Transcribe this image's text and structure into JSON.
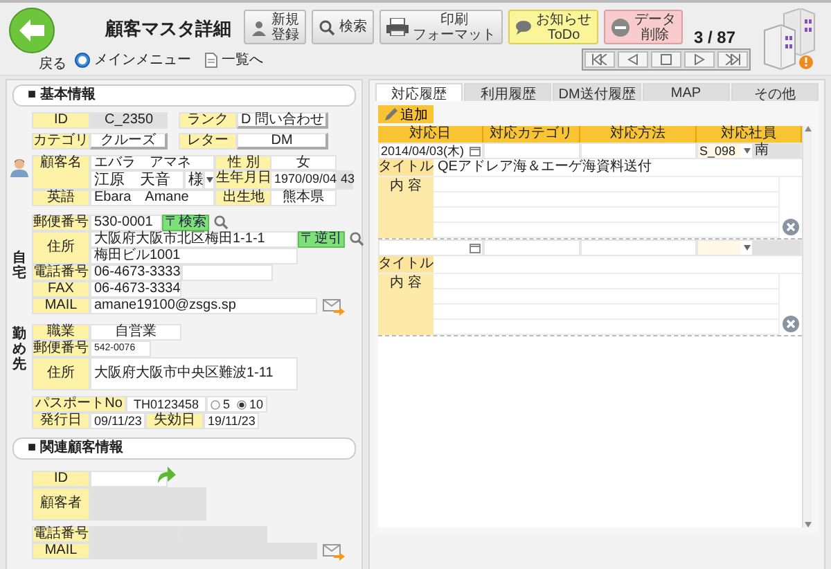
{
  "header": {
    "back_label": "戻る",
    "title": "顧客マスタ詳細",
    "buttons": [
      {
        "kind": "new",
        "lines": [
          "新規",
          "登録"
        ]
      },
      {
        "kind": "search",
        "lines": [
          "検索"
        ]
      },
      {
        "kind": "print",
        "lines": [
          "印刷",
          "フォーマット"
        ]
      },
      {
        "kind": "notice",
        "lines": [
          "お知らせ",
          "ToDo"
        ]
      },
      {
        "kind": "delete",
        "lines": [
          "データ",
          "削除"
        ]
      }
    ],
    "links": [
      {
        "kind": "home",
        "label": "メインメニュー"
      },
      {
        "kind": "list",
        "label": "一覧へ"
      }
    ],
    "counter": "3 / 87"
  },
  "basic": {
    "heading": "■ 基本情報",
    "id": {
      "label": "ID",
      "value": "C_2350"
    },
    "rank": {
      "label": "ランク",
      "value": "D 問い合わせ"
    },
    "category": {
      "label": "カテゴリ",
      "value": "クルーズ"
    },
    "letter": {
      "label": "レター",
      "value": "DM"
    },
    "name": {
      "label": "顧客名",
      "furigana": "エバラ　アマネ",
      "value": "江原　天音",
      "honorific": "様"
    },
    "gender": {
      "label": "性 別",
      "value": "女"
    },
    "birthdate": {
      "label": "生年月日",
      "value": "1970/09/04",
      "age": "43"
    },
    "english": {
      "label": "英語",
      "value": "Ebara　Amane"
    },
    "birthplace": {
      "label": "出生地",
      "value": "熊本県"
    }
  },
  "home": {
    "side_label": "自宅",
    "postal": {
      "label": "郵便番号",
      "value": "530-0001",
      "button": "〒検索"
    },
    "address": {
      "label": "住所",
      "line1": "大阪府大阪市北区梅田1-1-1",
      "line2": "梅田ビル1001",
      "button": "〒逆引"
    },
    "phone": {
      "label": "電話番号",
      "value": "06-4673-3333"
    },
    "fax": {
      "label": "FAX",
      "value": "06-4673-3334"
    },
    "mail": {
      "label": "MAIL",
      "value": "amane19100@zsgs.sp"
    }
  },
  "work": {
    "side_label": "勤め先",
    "occupation": {
      "label": "職業",
      "value": "自営業"
    },
    "postal": {
      "label": "郵便番号",
      "value": "542-0076"
    },
    "address": {
      "label": "住所",
      "value": "大阪府大阪市中央区難波1-11"
    }
  },
  "passport": {
    "label": "パスポートNo",
    "value": "TH0123458",
    "options": [
      {
        "label": "5",
        "selected": false
      },
      {
        "label": "10",
        "selected": true
      }
    ],
    "issued": {
      "label": "発行日",
      "value": "09/11/23"
    },
    "expires": {
      "label": "失効日",
      "value": "19/11/23"
    }
  },
  "related": {
    "heading": "■ 関連顧客情報",
    "id_label": "ID",
    "customer_label": "顧客者",
    "phone_label": "電話番号",
    "mail_label": "MAIL"
  },
  "tabs": [
    {
      "label": "対応履歴",
      "selected": true
    },
    {
      "label": "利用履歴",
      "selected": false
    },
    {
      "label": "DM送付履歴",
      "selected": false
    },
    {
      "label": "MAP",
      "selected": false
    },
    {
      "label": "その他",
      "selected": false
    }
  ],
  "add_button": "追加",
  "history": {
    "columns": [
      "対応日",
      "対応カテゴリ",
      "対応方法",
      "対応社員"
    ],
    "records": [
      {
        "date": "2014/04/03(木)",
        "staff_id": "S_098",
        "staff_name": "南",
        "title_label": "タイトル",
        "title": "QEアドレア海＆エーゲ海資料送付",
        "content_label": "内 容"
      },
      {
        "title_label": "タイトル",
        "content_label": "内 容"
      }
    ]
  }
}
